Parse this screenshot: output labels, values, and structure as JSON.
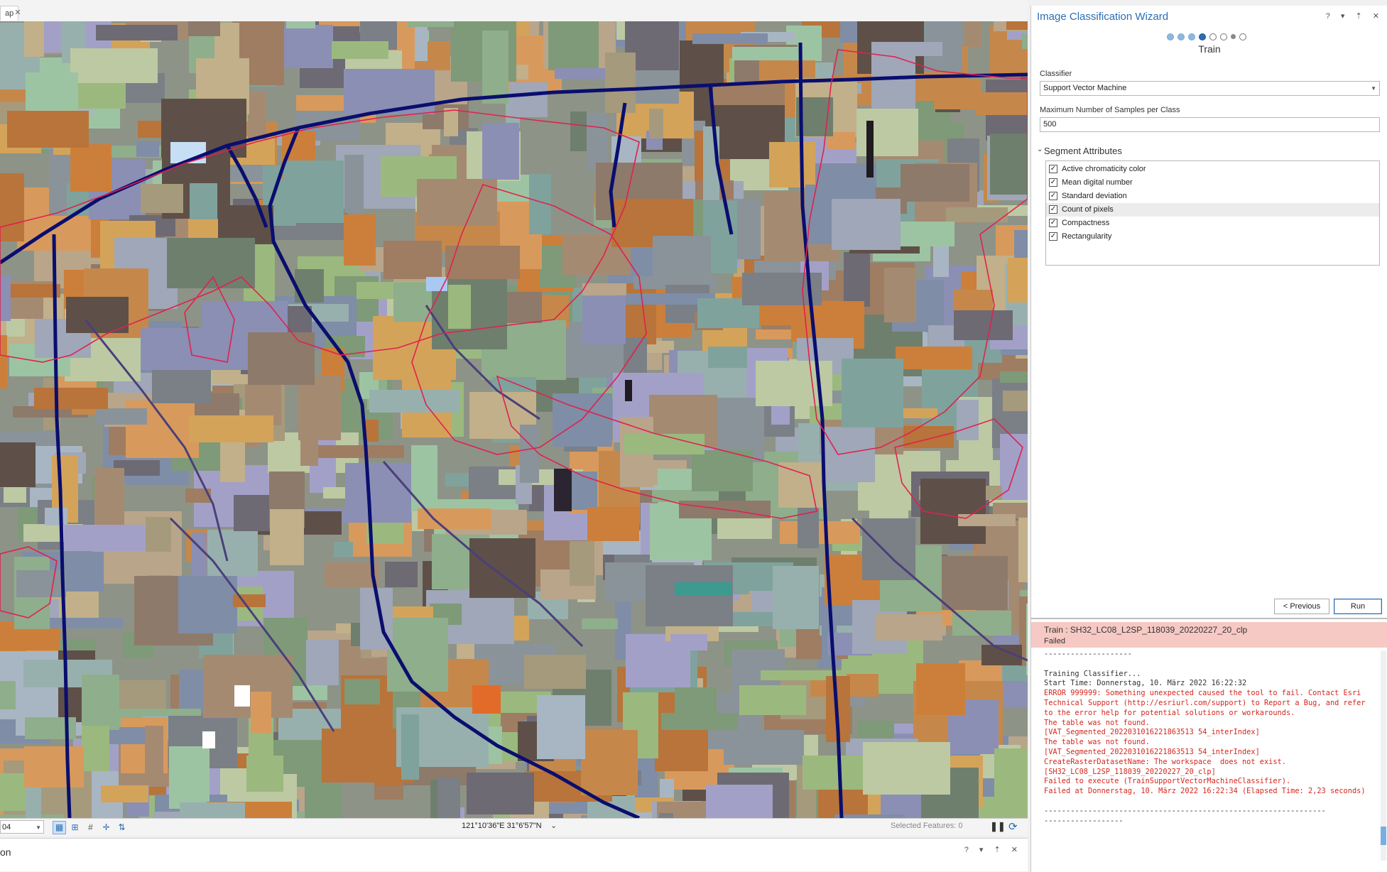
{
  "map": {
    "tab_label": "ap",
    "tab_close": "✕",
    "scale_value": "04",
    "coordinates": "121°10'36\"E 31°6'57\"N",
    "selected_features": "Selected Features: 0",
    "bottom_panel_title": "on",
    "bottom_panel_controls": "? ▾ ⇡ ✕",
    "icons": [
      "select-icon",
      "attribute-icon",
      "grid-icon",
      "snap-icon",
      "navigate-icon"
    ]
  },
  "wizard": {
    "title": "Image Classification Wizard",
    "title_controls": "? ▾ ⇡ ✕",
    "step_label": "Train",
    "steps": [
      "done",
      "done",
      "done",
      "current",
      "todo",
      "todo",
      "small",
      "todo"
    ],
    "classifier_label": "Classifier",
    "classifier_value": "Support Vector Machine",
    "max_samples_label": "Maximum Number of Samples per Class",
    "max_samples_value": "500",
    "segment_attributes_header": "Segment Attributes",
    "segment_attributes": [
      {
        "label": "Active chromaticity color",
        "checked": true
      },
      {
        "label": "Mean digital number",
        "checked": true
      },
      {
        "label": "Standard deviation",
        "checked": true
      },
      {
        "label": "Count of pixels",
        "checked": true
      },
      {
        "label": "Compactness",
        "checked": true
      },
      {
        "label": "Rectangularity",
        "checked": true
      }
    ],
    "previous_label": "< Previous",
    "run_label": "Run"
  },
  "messages": {
    "title": "Train : SH32_LC08_L2SP_118039_20220227_20_clp",
    "status": "Failed",
    "separator_top": "--------------------",
    "lines": [
      {
        "text": "Training Classifier...",
        "error": false
      },
      {
        "text": "Start Time: Donnerstag, 10. März 2022 16:22:32",
        "error": false
      },
      {
        "text": "ERROR 999999: Something unexpected caused the tool to fail. Contact Esri Technical Support (http://esriurl.com/support) to Report a Bug, and refer to the error help for potential solutions or workarounds.",
        "error": true
      },
      {
        "text": "The table was not found.",
        "error": true
      },
      {
        "text": "[VAT_Segmented_2022031016221863513 54_interIndex]",
        "error": true
      },
      {
        "text": "The table was not found.",
        "error": true
      },
      {
        "text": "[VAT_Segmented_2022031016221863513 54_interIndex]",
        "error": true
      },
      {
        "text": "CreateRasterDatasetName: The workspace  does not exist.",
        "error": true
      },
      {
        "text": "[SH32_LC08_L2SP_118039_20220227_20_clp]",
        "error": true
      },
      {
        "text": "Failed to execute (TrainSupportVectorMachineClassifier).",
        "error": true
      },
      {
        "text": "Failed at Donnerstag, 10. März 2022 16:22:34 (Elapsed Time: 2,23 seconds)",
        "error": true
      }
    ],
    "separator_bottom": "----------------------------------------------------------------\n------------------"
  }
}
